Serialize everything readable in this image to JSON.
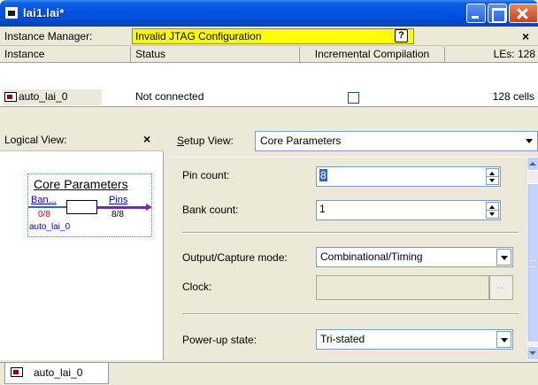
{
  "window": {
    "title": "lai1.lai*"
  },
  "instance_manager": {
    "label": "Instance Manager:",
    "status": "Invalid JTAG Configuration",
    "help": "?",
    "close": "×"
  },
  "table": {
    "columns": [
      "Instance",
      "Status",
      "Incremental Compilation",
      "LEs: 128"
    ],
    "rows": [
      {
        "instance": "auto_lai_0",
        "status": "Not connected",
        "incremental_compilation_checked": false,
        "les": "128 cells"
      }
    ]
  },
  "logical_view": {
    "title": "Logical View:",
    "close": "×",
    "block": {
      "title": "Core Parameters",
      "left_port": "Ban...",
      "right_port": "Pins",
      "left_count": "0/8",
      "right_count": "8/8",
      "instance": "auto_lai_0"
    }
  },
  "setup_view": {
    "label_prefix": "S",
    "label_rest": "etup View:",
    "selected": "Core Parameters",
    "fields": {
      "pin_count_label": "Pin count:",
      "pin_count_value": "8",
      "bank_count_label": "Bank count:",
      "bank_count_value": "1",
      "output_capture_label": "Output/Capture mode:",
      "output_capture_value": "Combinational/Timing",
      "clock_label": "Clock:",
      "clock_value": "",
      "clock_button": "...",
      "powerup_label": "Power-up state:",
      "powerup_value": "Tri-stated"
    }
  },
  "bottom_tab": {
    "label": "auto_lai_0"
  },
  "colors": {
    "title_bar": "#0054e3",
    "status_highlight": "#ffff00",
    "left_signal": "#1a6be0",
    "right_signal": "#7a1fd6"
  }
}
